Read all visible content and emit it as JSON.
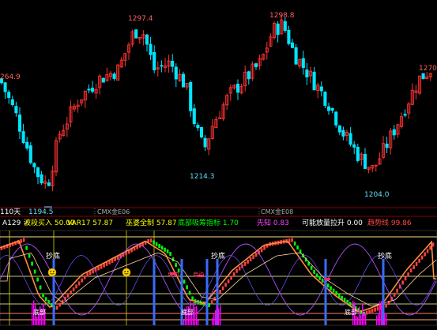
{
  "window": {
    "title": ""
  },
  "main_chart": {
    "price_labels": {
      "high_1": "1297.4",
      "high_2": "1298.8",
      "left_edge": "264.9",
      "right_edge": "1270",
      "low_1": "1214.3",
      "low_2": "1194.5",
      "low_3": "1204.0"
    },
    "period_label": "110天",
    "contract_labels": [
      "CMX金E06",
      "CMX金E08"
    ]
  },
  "indicator_bar": {
    "items": [
      {
        "label": "A129",
        "value": "",
        "color": "#ffffff"
      },
      {
        "label": "波段买入",
        "value": "50.00",
        "color": "#ffff00"
      },
      {
        "label": "VAR17",
        "value": "57.87",
        "color": "#ffff00"
      },
      {
        "label": "巫婆全制",
        "value": "57.87",
        "color": "#ffff00"
      },
      {
        "label": "底部吸筹指标",
        "value": "1.70",
        "color": "#00ff00"
      },
      {
        "label": "先知",
        "value": "0.83",
        "color": "#ff44ff"
      },
      {
        "label": "可能放量拉升",
        "value": "0.00",
        "color": "#ffffff"
      },
      {
        "label": "趋势线",
        "value": "99.86",
        "color": "#ff4444"
      }
    ]
  },
  "sub_chart": {
    "buy_labels": [
      "抄底",
      "抄底",
      "抄底"
    ],
    "hint_labels": [
      "底部",
      "底部",
      "底部"
    ],
    "side_labels": [
      "启动",
      "启动"
    ]
  },
  "colors": {
    "up": "#ff3232",
    "down": "#00e5ff",
    "grid": "#8b0000",
    "indicator_orange": "#ffb060",
    "indicator_green": "#00ff00",
    "indicator_magenta": "#ff00ff",
    "indicator_blue": "#3a6bff",
    "indicator_yellow": "#ffff00"
  }
}
